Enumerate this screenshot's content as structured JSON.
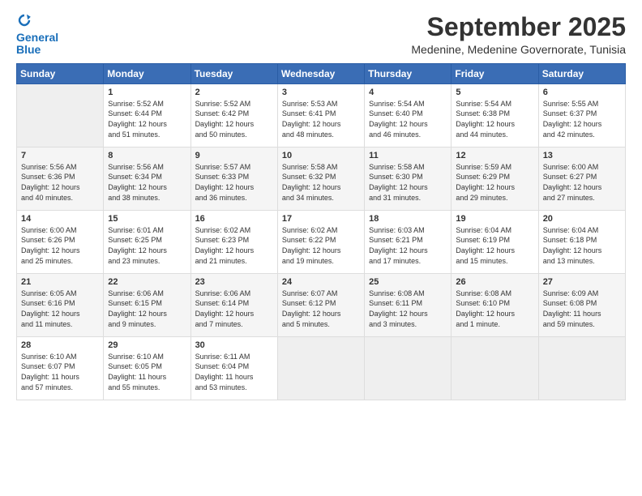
{
  "header": {
    "logo_line1": "General",
    "logo_line2": "Blue",
    "month_title": "September 2025",
    "location": "Medenine, Medenine Governorate, Tunisia"
  },
  "weekdays": [
    "Sunday",
    "Monday",
    "Tuesday",
    "Wednesday",
    "Thursday",
    "Friday",
    "Saturday"
  ],
  "weeks": [
    [
      {
        "day": "",
        "info": ""
      },
      {
        "day": "1",
        "info": "Sunrise: 5:52 AM\nSunset: 6:44 PM\nDaylight: 12 hours\nand 51 minutes."
      },
      {
        "day": "2",
        "info": "Sunrise: 5:52 AM\nSunset: 6:42 PM\nDaylight: 12 hours\nand 50 minutes."
      },
      {
        "day": "3",
        "info": "Sunrise: 5:53 AM\nSunset: 6:41 PM\nDaylight: 12 hours\nand 48 minutes."
      },
      {
        "day": "4",
        "info": "Sunrise: 5:54 AM\nSunset: 6:40 PM\nDaylight: 12 hours\nand 46 minutes."
      },
      {
        "day": "5",
        "info": "Sunrise: 5:54 AM\nSunset: 6:38 PM\nDaylight: 12 hours\nand 44 minutes."
      },
      {
        "day": "6",
        "info": "Sunrise: 5:55 AM\nSunset: 6:37 PM\nDaylight: 12 hours\nand 42 minutes."
      }
    ],
    [
      {
        "day": "7",
        "info": "Sunrise: 5:56 AM\nSunset: 6:36 PM\nDaylight: 12 hours\nand 40 minutes."
      },
      {
        "day": "8",
        "info": "Sunrise: 5:56 AM\nSunset: 6:34 PM\nDaylight: 12 hours\nand 38 minutes."
      },
      {
        "day": "9",
        "info": "Sunrise: 5:57 AM\nSunset: 6:33 PM\nDaylight: 12 hours\nand 36 minutes."
      },
      {
        "day": "10",
        "info": "Sunrise: 5:58 AM\nSunset: 6:32 PM\nDaylight: 12 hours\nand 34 minutes."
      },
      {
        "day": "11",
        "info": "Sunrise: 5:58 AM\nSunset: 6:30 PM\nDaylight: 12 hours\nand 31 minutes."
      },
      {
        "day": "12",
        "info": "Sunrise: 5:59 AM\nSunset: 6:29 PM\nDaylight: 12 hours\nand 29 minutes."
      },
      {
        "day": "13",
        "info": "Sunrise: 6:00 AM\nSunset: 6:27 PM\nDaylight: 12 hours\nand 27 minutes."
      }
    ],
    [
      {
        "day": "14",
        "info": "Sunrise: 6:00 AM\nSunset: 6:26 PM\nDaylight: 12 hours\nand 25 minutes."
      },
      {
        "day": "15",
        "info": "Sunrise: 6:01 AM\nSunset: 6:25 PM\nDaylight: 12 hours\nand 23 minutes."
      },
      {
        "day": "16",
        "info": "Sunrise: 6:02 AM\nSunset: 6:23 PM\nDaylight: 12 hours\nand 21 minutes."
      },
      {
        "day": "17",
        "info": "Sunrise: 6:02 AM\nSunset: 6:22 PM\nDaylight: 12 hours\nand 19 minutes."
      },
      {
        "day": "18",
        "info": "Sunrise: 6:03 AM\nSunset: 6:21 PM\nDaylight: 12 hours\nand 17 minutes."
      },
      {
        "day": "19",
        "info": "Sunrise: 6:04 AM\nSunset: 6:19 PM\nDaylight: 12 hours\nand 15 minutes."
      },
      {
        "day": "20",
        "info": "Sunrise: 6:04 AM\nSunset: 6:18 PM\nDaylight: 12 hours\nand 13 minutes."
      }
    ],
    [
      {
        "day": "21",
        "info": "Sunrise: 6:05 AM\nSunset: 6:16 PM\nDaylight: 12 hours\nand 11 minutes."
      },
      {
        "day": "22",
        "info": "Sunrise: 6:06 AM\nSunset: 6:15 PM\nDaylight: 12 hours\nand 9 minutes."
      },
      {
        "day": "23",
        "info": "Sunrise: 6:06 AM\nSunset: 6:14 PM\nDaylight: 12 hours\nand 7 minutes."
      },
      {
        "day": "24",
        "info": "Sunrise: 6:07 AM\nSunset: 6:12 PM\nDaylight: 12 hours\nand 5 minutes."
      },
      {
        "day": "25",
        "info": "Sunrise: 6:08 AM\nSunset: 6:11 PM\nDaylight: 12 hours\nand 3 minutes."
      },
      {
        "day": "26",
        "info": "Sunrise: 6:08 AM\nSunset: 6:10 PM\nDaylight: 12 hours\nand 1 minute."
      },
      {
        "day": "27",
        "info": "Sunrise: 6:09 AM\nSunset: 6:08 PM\nDaylight: 11 hours\nand 59 minutes."
      }
    ],
    [
      {
        "day": "28",
        "info": "Sunrise: 6:10 AM\nSunset: 6:07 PM\nDaylight: 11 hours\nand 57 minutes."
      },
      {
        "day": "29",
        "info": "Sunrise: 6:10 AM\nSunset: 6:05 PM\nDaylight: 11 hours\nand 55 minutes."
      },
      {
        "day": "30",
        "info": "Sunrise: 6:11 AM\nSunset: 6:04 PM\nDaylight: 11 hours\nand 53 minutes."
      },
      {
        "day": "",
        "info": ""
      },
      {
        "day": "",
        "info": ""
      },
      {
        "day": "",
        "info": ""
      },
      {
        "day": "",
        "info": ""
      }
    ]
  ]
}
